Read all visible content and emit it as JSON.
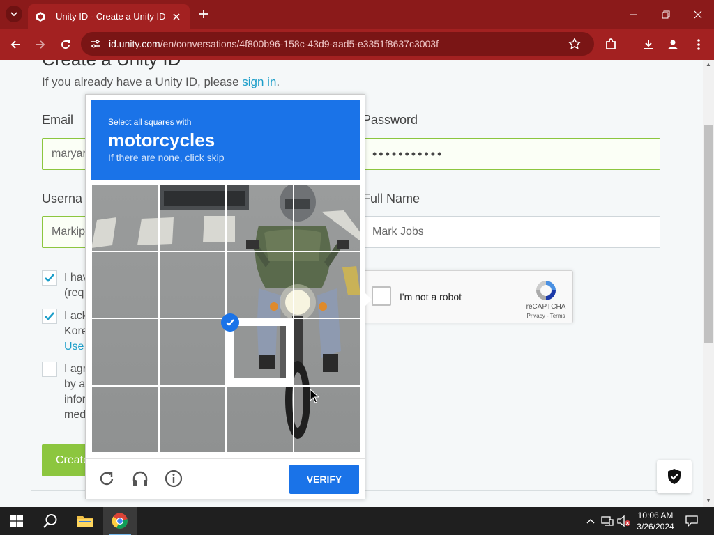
{
  "browser": {
    "tab_title": "Unity ID - Create a Unity ID",
    "url_host": "id.unity.com",
    "url_path": "/en/conversations/4f800b96-158c-43d9-aad5-e3351f8637c3003f"
  },
  "page": {
    "heading_partial": "Create a Unity ID",
    "signin_prefix": "If you already have a Unity ID, please ",
    "signin_link": "sign in",
    "signin_suffix": ".",
    "email_label": "Email",
    "email_value": "maryar",
    "password_label": "Password",
    "password_value": "•••••••••••",
    "username_label": "Userna",
    "username_value": "Markip",
    "fullname_label": "Full Name",
    "fullname_value": "Mark Jobs",
    "checks": [
      {
        "lines": [
          "I hav",
          "(req"
        ],
        "checked": true
      },
      {
        "lines": [
          "I ack",
          "Kore",
          "Use"
        ],
        "checked": true
      },
      {
        "lines": [
          "I agr",
          "by a",
          "infor",
          "med"
        ],
        "checked": false
      }
    ],
    "create_button": "Create"
  },
  "recaptcha_anchor": {
    "label": "I'm not a robot",
    "brand": "reCAPTCHA",
    "terms": "Privacy - Terms"
  },
  "challenge": {
    "instruction": "Select all squares with",
    "target": "motorcycles",
    "hint": "If there are none, click skip",
    "selected_tiles": [
      10
    ],
    "verify_label": "VERIFY"
  },
  "taskbar": {
    "time": "10:06 AM",
    "date": "3/26/2024"
  },
  "colors": {
    "chrome_frame": "#8b1a1a",
    "recaptcha_blue": "#1a73e8",
    "unity_green": "#8cc63f",
    "link": "#1b9ec9"
  }
}
